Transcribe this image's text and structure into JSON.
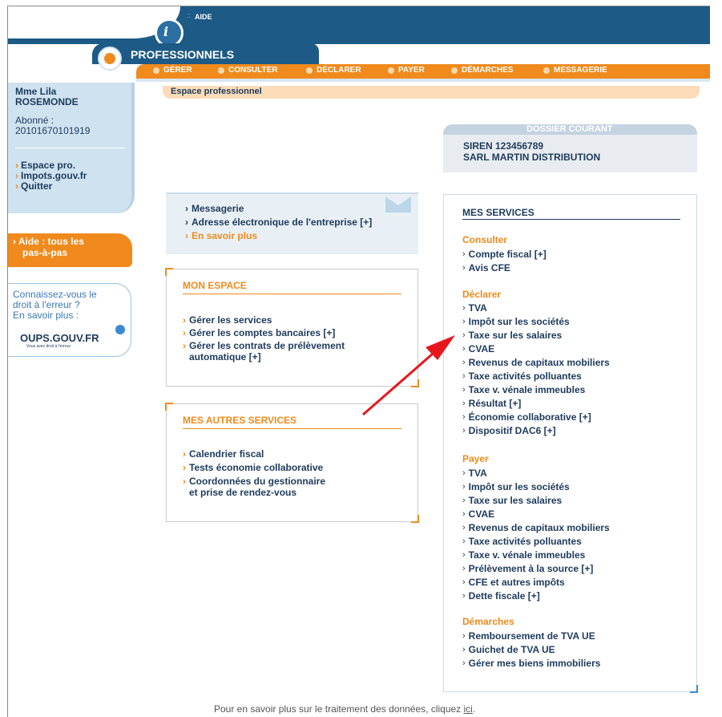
{
  "header": {
    "site": "impots.gouv.fr",
    "aide": "AIDE",
    "section": "PROFESSIONNELS",
    "nav": [
      "GÉRER",
      "CONSULTER",
      "DÉCLARER",
      "PAYER",
      "DÉMARCHES",
      "MESSAGERIE"
    ],
    "breadcrumb": "Espace professionnel"
  },
  "user": {
    "name_line1": "Mme  Lila",
    "name_line2": "ROSEMONDE",
    "abonne_label": "Abonné :",
    "abonne_number": "20101670101919",
    "links": [
      "Espace pro.",
      "Impots.gouv.fr",
      "Quitter"
    ]
  },
  "aide": {
    "line1": "Aide : tous les",
    "line2": "pas-à-pas"
  },
  "oups": {
    "line1": "Connaissez-vous le",
    "line2": "droit à l'erreur ?",
    "line3": "En savoir plus :",
    "logo": "OUPS.GOUV.FR",
    "tagline": "Vous avez droit à l'erreur"
  },
  "messagerie": {
    "items": [
      "Messagerie",
      "Adresse électronique de l'entreprise [+]",
      "En savoir plus"
    ]
  },
  "mon_espace": {
    "title": "MON ESPACE",
    "items": [
      "Gérer les services",
      "Gérer les comptes bancaires [+]",
      "Gérer les contrats de prélèvement",
      "automatique [+]"
    ]
  },
  "autres": {
    "title": "MES AUTRES SERVICES",
    "items": [
      "Calendrier fiscal",
      "Tests économie collaborative",
      "Coordonnées du gestionnaire",
      "et prise de rendez-vous"
    ]
  },
  "dossier": {
    "title": "DOSSIER COURANT",
    "siren": "SIREN 123456789",
    "company": "SARL MARTIN DISTRIBUTION"
  },
  "services": {
    "title": "MES SERVICES",
    "consulter": {
      "label": "Consulter",
      "items": [
        "Compte fiscal [+]",
        "Avis CFE"
      ]
    },
    "declarer": {
      "label": "Déclarer",
      "items": [
        "TVA",
        "Impôt sur les sociétés",
        "Taxe sur les salaires",
        "CVAE",
        "Revenus de capitaux mobiliers",
        "Taxe activités polluantes",
        "Taxe v. vénale immeubles",
        "Résultat [+]",
        "Économie collaborative [+]",
        "Dispositif DAC6 [+]"
      ]
    },
    "payer": {
      "label": "Payer",
      "items": [
        "TVA",
        "Impôt sur les sociétés",
        "Taxe sur les salaires",
        "CVAE",
        "Revenus de capitaux mobiliers",
        "Taxe activités polluantes",
        "Taxe v. vénale immeubles",
        "Prélèvement à la source [+]",
        "CFE et autres impôts",
        "Dette fiscale [+]"
      ]
    },
    "demarches": {
      "label": "Démarches",
      "items": [
        "Remboursement de TVA UE",
        "Guichet de TVA UE",
        "Gérer mes biens immobiliers"
      ]
    }
  },
  "footer": {
    "text": "Pour en savoir plus sur le traitement des données, cliquez ",
    "link": "ici",
    "end": "."
  },
  "colors": {
    "brand_blue": "#1d5a86",
    "orange": "#f08a1c",
    "arrow": "#e8171d"
  }
}
